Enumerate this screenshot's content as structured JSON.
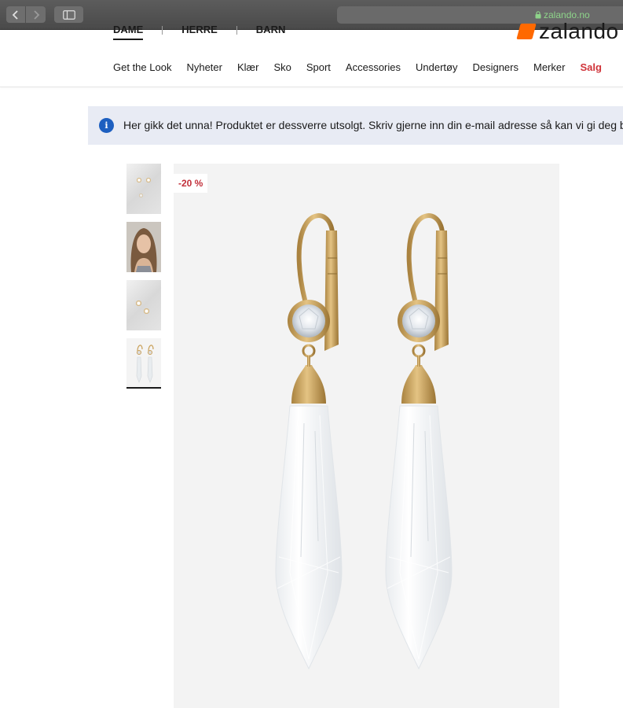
{
  "browser": {
    "url": "zalando.no"
  },
  "header": {
    "gender_tabs": [
      "DAME",
      "HERRE",
      "BARN"
    ],
    "logo": "zalando",
    "categories": [
      "Get the Look",
      "Nyheter",
      "Klær",
      "Sko",
      "Sport",
      "Accessories",
      "Undertøy",
      "Designers",
      "Merker",
      "Salg"
    ]
  },
  "notice": {
    "icon": "info-icon",
    "text": "Her gikk det unna! Produktet er dessverre utsolgt. Skriv gjerne inn din e-mail adresse så kan vi gi deg beskjed"
  },
  "product": {
    "discount_badge": "-20 %",
    "thumbnail_count": 4,
    "selected_thumbnail": 4
  },
  "colors": {
    "sale": "#d0343a",
    "discount": "#c22f3a",
    "info_icon": "#1d5fc0",
    "notice_bg": "#e8ebf4",
    "brand": "#ff6900",
    "gold": "#c9a15b"
  }
}
